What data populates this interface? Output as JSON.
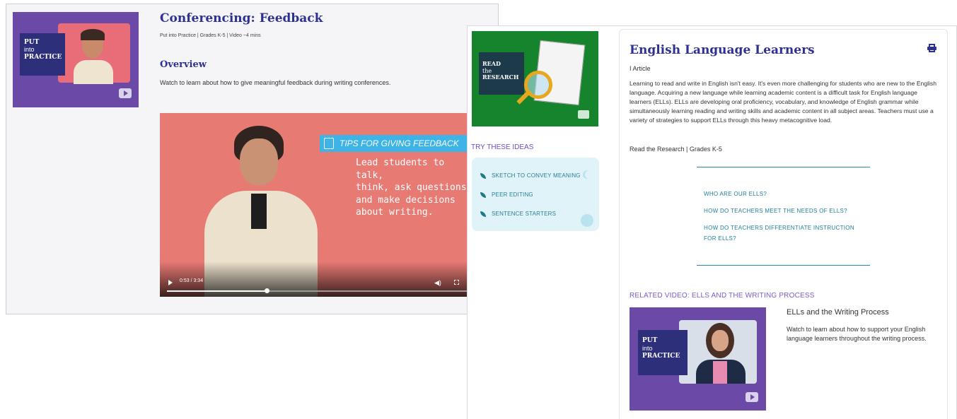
{
  "left": {
    "badge_put": "PUT",
    "badge_into": "into",
    "badge_practice": "PRACTICE",
    "title": "Conferencing: Feedback",
    "meta": "Put into Practice | Grades K-5 | Video ~4 mins",
    "overview_heading": "Overview",
    "overview_text": "Watch to learn about how to give meaningful feedback during writing conferences.",
    "video": {
      "tip_banner": "TIPS FOR GIVING FEEDBACK",
      "tip_line1": "Lead students to talk,",
      "tip_line2": "think, ask questions,",
      "tip_line3": "and make decisions",
      "tip_line4": "about writing.",
      "time": "0:53 / 3:34",
      "progress": 0.33
    }
  },
  "right": {
    "research_badge_read": "READ",
    "research_badge_the": "the",
    "research_badge_research": "RESEARCH",
    "try_heading": "TRY THESE IDEAS",
    "ideas": [
      "SKETCH TO CONVEY MEANING",
      "PEER EDITING",
      "SENTENCE STARTERS"
    ],
    "title": "English Language Learners",
    "type": "I Article",
    "body": "Learning to read and write in English isn't easy. It's even more challenging for students who are new to the English language. Acquiring a new language while learning academic content is a difficult task for English language learners (ELLs). ELLs are developing oral proficiency, vocabulary, and knowledge of English grammar while simultaneously learning reading and writing skills and academic content in all subject areas. Teachers must use a variety of strategies to support ELLs through this heavy metacognitive load.",
    "meta": "Read the Research | Grades K-5",
    "toc": [
      "WHO ARE OUR ELLS?",
      "HOW DO TEACHERS MEET THE NEEDS OF ELLS?",
      "HOW DO TEACHERS DIFFERENTIATE INSTRUCTION",
      "FOR ELLS?"
    ],
    "related_heading": "RELATED VIDEO: ELLS AND THE WRITING PROCESS",
    "related_badge_put": "PUT",
    "related_badge_into": "into",
    "related_badge_practice": "PRACTICE",
    "related_title": "ELLs and the Writing Process",
    "related_desc": "Watch to learn about how to support your English language learners throughout the writing process."
  },
  "colors": {
    "navy": "#2e3192",
    "purple": "#6a4aa6",
    "green": "#16842d",
    "teal": "#1c7f9b",
    "violet": "#7b5ad1"
  }
}
